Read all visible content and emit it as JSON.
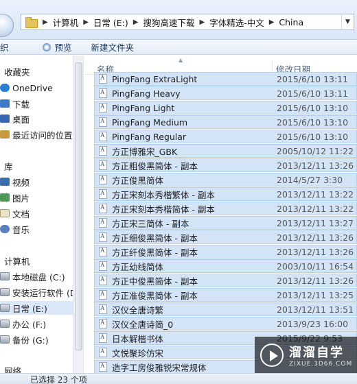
{
  "address": {
    "crumbs": [
      "计算机",
      "日常 (E:)",
      "搜狗高速下载",
      "字体精选-中文",
      "China"
    ]
  },
  "toolbar": {
    "left_cut": "织",
    "preview": "预览",
    "new_folder": "新建文件夹"
  },
  "nav": {
    "favorites": "收藏夹",
    "onedrive": "OneDrive",
    "downloads": "下载",
    "desktop": "桌面",
    "recent": "最近访问的位置",
    "libraries": "库",
    "videos": "视频",
    "pictures": "图片",
    "documents": "文档",
    "music": "音乐",
    "computer": "计算机",
    "drive_c": "本地磁盘 (C:)",
    "drive_d": "安装运行软件 (D",
    "drive_e": "日常 (E:)",
    "drive_f": "办公 (F:)",
    "drive_g": "备份 (G:)",
    "network": "网络"
  },
  "columns": {
    "name": "名称",
    "date": "修改日期"
  },
  "files": [
    {
      "name": "PingFang ExtraLight",
      "date": "2015/6/10 13:11",
      "selected": true
    },
    {
      "name": "PingFang Heavy",
      "date": "2015/6/10 13:11",
      "selected": true
    },
    {
      "name": "PingFang Light",
      "date": "2015/6/10 13:10",
      "selected": true
    },
    {
      "name": "PingFang Medium",
      "date": "2015/6/10 13:10",
      "selected": true
    },
    {
      "name": "PingFang Regular",
      "date": "2015/6/10 13:10",
      "selected": true
    },
    {
      "name": "方正博雅宋_GBK",
      "date": "2005/10/12 11:22",
      "selected": true
    },
    {
      "name": "方正粗俊黑简体 - 副本",
      "date": "2013/12/11 13:26",
      "selected": true
    },
    {
      "name": "方正俊黑简体",
      "date": "2014/5/27 3:30",
      "selected": true
    },
    {
      "name": "方正宋刻本秀楷繁体 - 副本",
      "date": "2013/12/11 13:22",
      "selected": true
    },
    {
      "name": "方正宋刻本秀楷简体 - 副本",
      "date": "2013/12/11 13:22",
      "selected": true
    },
    {
      "name": "方正宋三简体 - 副本",
      "date": "2013/12/11 13:27",
      "selected": true
    },
    {
      "name": "方正细俊黑简体 - 副本",
      "date": "2013/12/11 13:26",
      "selected": true
    },
    {
      "name": "方正纤俊黑简体 - 副本",
      "date": "2013/12/11 13:26",
      "selected": true
    },
    {
      "name": "方正幼线简体",
      "date": "2003/10/11 16:54",
      "selected": true
    },
    {
      "name": "方正中俊黑简体 - 副本",
      "date": "2013/12/11 13:26",
      "selected": true
    },
    {
      "name": "方正准俊黑简体 - 副本",
      "date": "2013/12/11 13:25",
      "selected": true
    },
    {
      "name": "汉仪全唐诗繁",
      "date": "2013/12/11 13:51",
      "selected": true
    },
    {
      "name": "汉仪全唐诗简_0",
      "date": "2013/9/23 16:00",
      "selected": true
    },
    {
      "name": "日本解楷书体",
      "date": "2015/9/22 9:53",
      "selected": true
    },
    {
      "name": "文悦聚珍仿宋",
      "date": "",
      "selected": true
    },
    {
      "name": "造字工房俊雅锐宋常规体",
      "date": "",
      "selected": true
    }
  ],
  "status": {
    "text": "已选择 23 个项"
  },
  "watermark": {
    "title": "溜溜自学",
    "sub": "ZIXUE.3D66.COM"
  }
}
